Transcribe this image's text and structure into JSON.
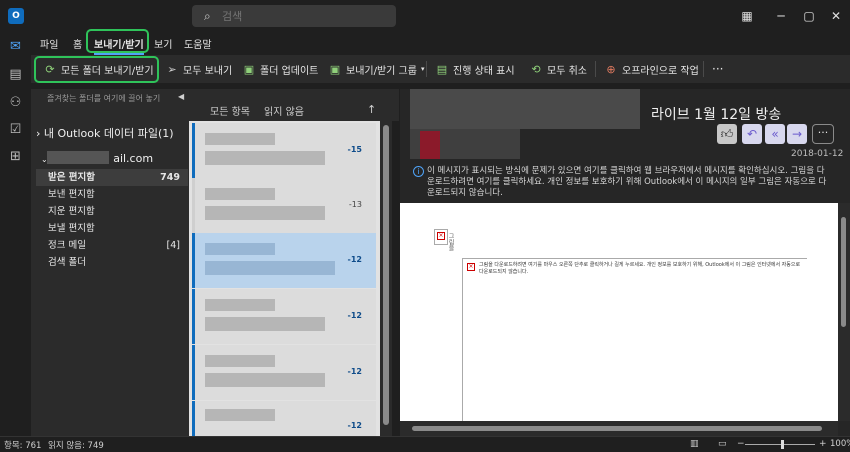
{
  "search": {
    "placeholder": "검색"
  },
  "window": {
    "minimize": "─",
    "maximize": "▢",
    "close": "✕"
  },
  "ribbon": {
    "tabs": [
      "파일",
      "홈",
      "보내기/받기",
      "보기",
      "도움말"
    ],
    "active_tab": "보내기/받기"
  },
  "toolbar": {
    "send_receive_all": "모든 폴더 보내기/받기",
    "send_all": "모두 보내기",
    "update_folder": "폴더 업데이트",
    "send_receive_groups": "보내기/받기 그룹",
    "show_progress": "진행 상태 표시",
    "cancel_all": "모두 취소",
    "work_offline": "오프라인으로 작업",
    "more": "···"
  },
  "folder_pane": {
    "favorites_hint": "즐겨찾는 폴더를 여기에 끌어 놓기",
    "root": "내 Outlook 데이터 파일(1)",
    "account_suffix": "ail.com",
    "folders": [
      {
        "name": "받은 편지함",
        "count": "749"
      },
      {
        "name": "보낸 편지함",
        "count": ""
      },
      {
        "name": "지운 편지함",
        "count": ""
      },
      {
        "name": "보낼 편지함",
        "count": ""
      },
      {
        "name": "정크 메일",
        "count": "[4]"
      },
      {
        "name": "검색 폴더",
        "count": ""
      }
    ]
  },
  "message_list": {
    "filter_all": "모든 항목",
    "filter_unread": "읽지 않음",
    "dates": [
      "-15",
      "-13",
      "-12",
      "-12",
      "-12",
      "-12"
    ]
  },
  "reading_pane": {
    "subject": "라이브 1월 12일 방송",
    "date": "2018-01-12",
    "info": "이 메시지가 표시되는 방식에 문제가 있으면 여기를 클릭하여 웹 브라우저에서 메시지를 확인하십시오. 그림을 다운로드하려면 여기를 클릭하세요. 개인 정보를 보호하기 위해 Outlook에서 이 메시지의 일부 그림은 자동으로 다운로드되지 않습니다.",
    "image_label": "그림을",
    "image_note": "그림을 다운로드하려면 여기를 마우스 오른쪽 단추로 클릭하거나 길게 누르세요. 개인 정보를 보호하기 위해, Outlook에서 이 그림은 인터넷에서 자동으로 다운로드되지 않습니다."
  },
  "status": {
    "items": "항목: 761",
    "unread": "읽지 않음: 749",
    "zoom": "100%"
  }
}
